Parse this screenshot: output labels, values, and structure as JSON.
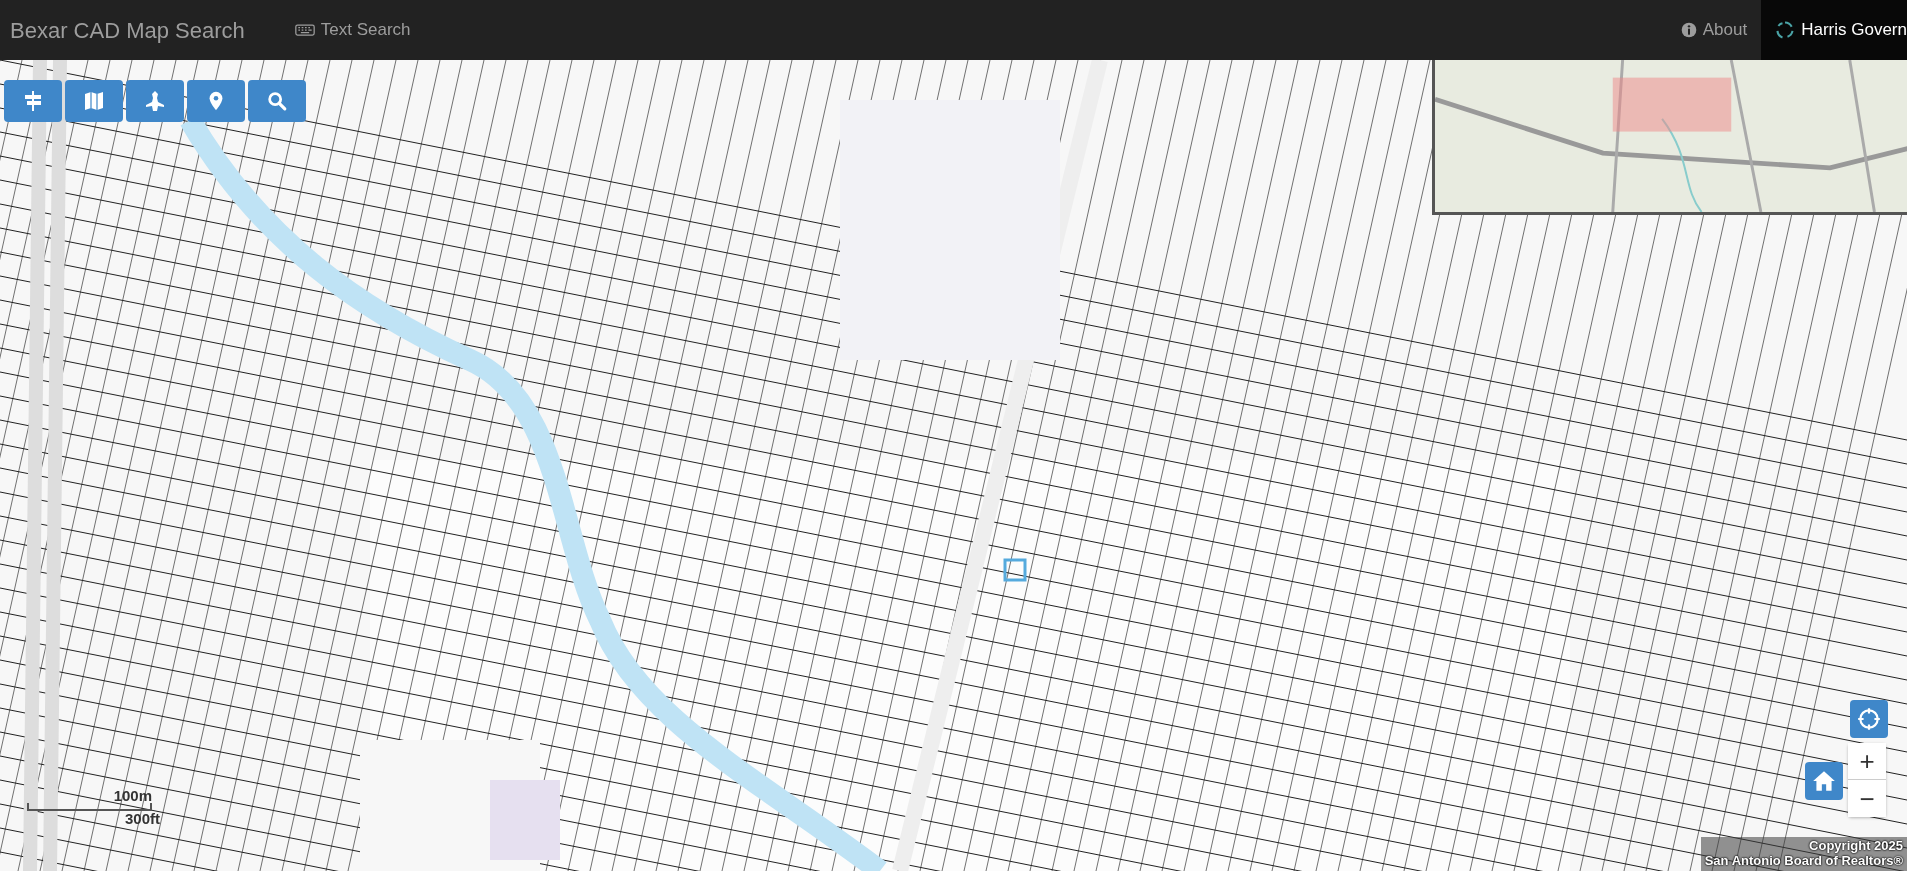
{
  "navbar": {
    "brand": "Bexar CAD Map Search",
    "links": [
      {
        "label": "Text Search"
      }
    ],
    "right_links": [
      {
        "label": "About",
        "kind": "plain"
      },
      {
        "label": "Harris Govern",
        "kind": "dark"
      }
    ]
  },
  "map_controls": {
    "zoom_in": "+",
    "zoom_out": "−"
  },
  "scale_bar": {
    "metric": "100m",
    "imperial": "300ft"
  },
  "attribution": [
    "Copyright 2025",
    "San Antonio Board of Realtors®"
  ]
}
